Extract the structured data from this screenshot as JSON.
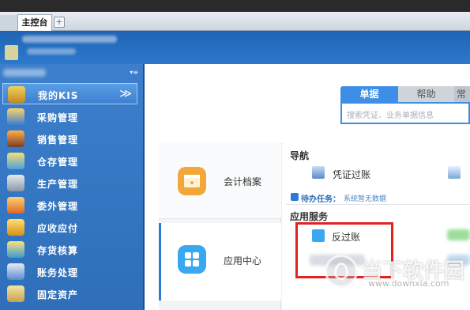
{
  "tabs": {
    "main_label": "主控台",
    "add_label": "+"
  },
  "sidebar": {
    "collapse_label": "▾≡",
    "items": [
      {
        "label": "我的KIS",
        "icon": "my-kis-icon",
        "active": true,
        "chevron": "≫"
      },
      {
        "label": "采购管理",
        "icon": "purchase-icon"
      },
      {
        "label": "销售管理",
        "icon": "sales-icon"
      },
      {
        "label": "仓存管理",
        "icon": "warehouse-icon"
      },
      {
        "label": "生产管理",
        "icon": "production-icon"
      },
      {
        "label": "委外管理",
        "icon": "outsourcing-icon"
      },
      {
        "label": "应收应付",
        "icon": "receivable-payable-icon"
      },
      {
        "label": "存货核算",
        "icon": "inventory-accounting-icon"
      },
      {
        "label": "账务处理",
        "icon": "accounting-icon"
      },
      {
        "label": "固定资产",
        "icon": "fixed-assets-icon"
      }
    ]
  },
  "search": {
    "tabs": [
      "单据",
      "帮助",
      "常"
    ],
    "placeholder": "搜索凭证、业务单据信息"
  },
  "cards": {
    "archive_label": "会计档案",
    "app_center_label": "应用中心"
  },
  "navigation": {
    "title": "导航",
    "voucher_post_label": "凭证过账",
    "todo_label": "待办任务：",
    "todo_message": "系统暂无数据"
  },
  "services": {
    "title": "应用服务",
    "reverse_post_label": "反过账"
  },
  "watermark": {
    "title": "当下软件园",
    "url": "www.downxia.com"
  },
  "colors": {
    "sidebar_blue": "#3c7fcc",
    "accent_blue": "#3e8ee8",
    "highlight_red": "#e02222",
    "archive_orange": "#f3a73a",
    "app_center_blue": "#3aa8f0"
  }
}
